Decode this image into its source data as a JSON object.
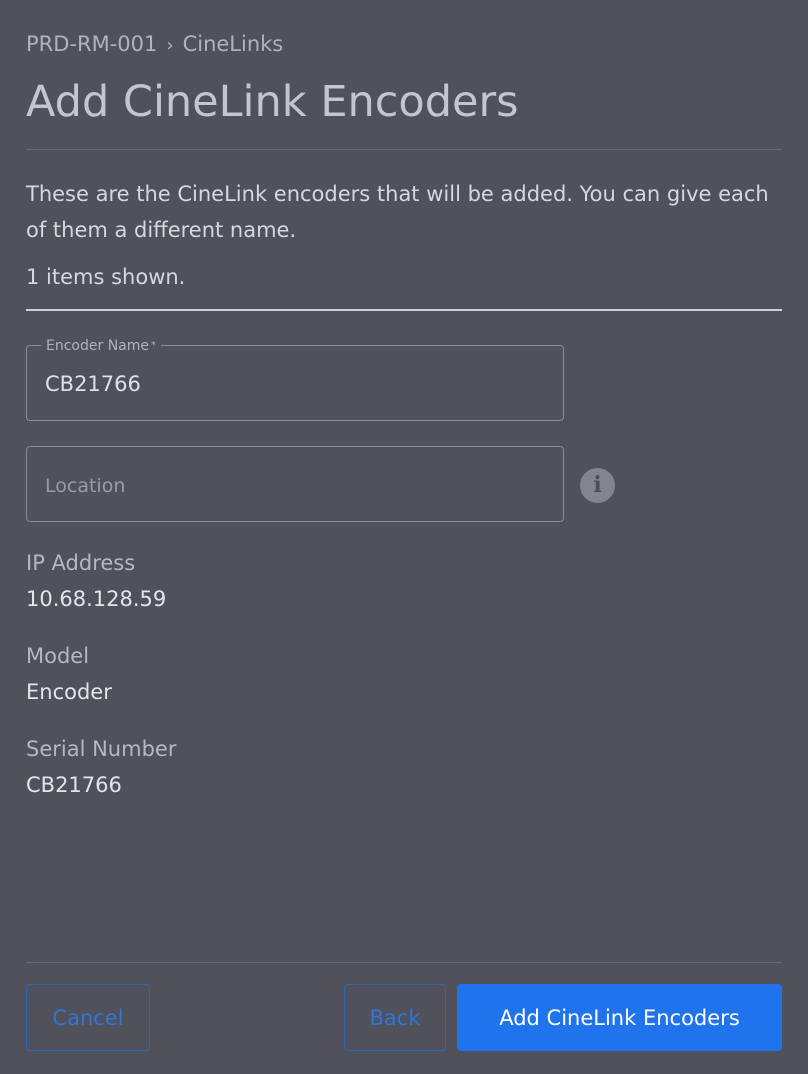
{
  "breadcrumb": {
    "items": [
      "PRD-RM-001",
      "CineLinks"
    ],
    "separator": "›"
  },
  "page": {
    "title": "Add CineLink Encoders",
    "intro": "These are the CineLink encoders that will be added. You can give each of them a different name.",
    "count_text": "1 items shown."
  },
  "encoder": {
    "name_label": "Encoder Name",
    "required_marker": "*",
    "name_value": "CB21766",
    "location_placeholder": "Location",
    "location_value": "",
    "info_icon": "info-icon",
    "info_glyph": "i",
    "ip_label": "IP Address",
    "ip_value": "10.68.128.59",
    "model_label": "Model",
    "model_value": "Encoder",
    "serial_label": "Serial Number",
    "serial_value": "CB21766"
  },
  "footer": {
    "cancel_label": "Cancel",
    "back_label": "Back",
    "submit_label": "Add CineLink Encoders"
  },
  "colors": {
    "background": "#50515a",
    "accent": "#1f74ee",
    "outline_button": "#2f76d6"
  }
}
